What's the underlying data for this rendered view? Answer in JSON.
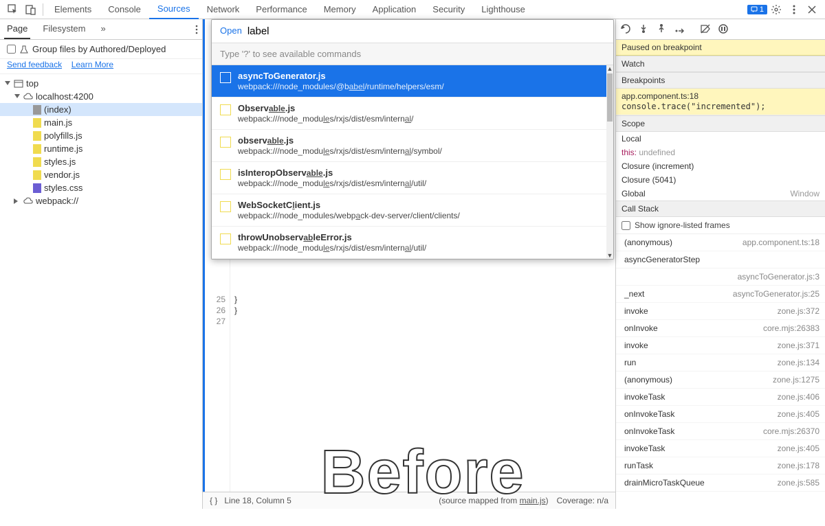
{
  "topTabs": {
    "items": [
      "Elements",
      "Console",
      "Sources",
      "Network",
      "Performance",
      "Memory",
      "Application",
      "Security",
      "Lighthouse"
    ],
    "active": "Sources",
    "badgeCount": "1"
  },
  "leftPanel": {
    "tabs": {
      "page": "Page",
      "filesystem": "Filesystem"
    },
    "grouping": {
      "label": "Group files by Authored/Deployed"
    },
    "links": {
      "feedback": "Send feedback",
      "learn": "Learn More"
    },
    "tree": {
      "top": "top",
      "host": "localhost:4200",
      "files": [
        "(index)",
        "main.js",
        "polyfills.js",
        "runtime.js",
        "styles.js",
        "vendor.js",
        "styles.css"
      ],
      "webpack": "webpack://"
    }
  },
  "palette": {
    "mode": "Open",
    "query": "label",
    "hint": "Type '?' to see available commands",
    "items": [
      {
        "name": "asyncToGenerator.js",
        "path": "webpack:///node_modules/@babel/runtime/helpers/esm/"
      },
      {
        "name": "Observable.js",
        "path": "webpack:///node_modules/rxjs/dist/esm/internal/"
      },
      {
        "name": "observable.js",
        "path": "webpack:///node_modules/rxjs/dist/esm/internal/symbol/"
      },
      {
        "name": "isInteropObservable.js",
        "path": "webpack:///node_modules/rxjs/dist/esm/internal/util/"
      },
      {
        "name": "WebSocketClient.js",
        "path": "webpack:///node_modules/webpack-dev-server/client/clients/"
      },
      {
        "name": "throwUnobservableError.js",
        "path": "webpack:///node_modules/rxjs/dist/esm/internal/util/"
      }
    ]
  },
  "gutter": {
    "l25": "25",
    "l26": "26",
    "l27": "27"
  },
  "code": {
    "l25": "  }",
    "l26": "}"
  },
  "overlayText": "Before",
  "status": {
    "pos": "Line 18, Column 5",
    "mapped": "(source mapped from ",
    "mappedFile": "main.js",
    "mappedEnd": ")",
    "coverage": "Coverage: n/a"
  },
  "debugger": {
    "paused": "Paused on breakpoint",
    "sections": {
      "watch": "Watch",
      "breakpoints": "Breakpoints",
      "scope": "Scope",
      "callstack": "Call Stack"
    },
    "bp": {
      "file": "app.component.ts:18",
      "code": "console.trace(\"incremented\");"
    },
    "scope": {
      "local": "Local",
      "thisLabel": "this:",
      "thisVal": "undefined",
      "c1": "Closure (increment)",
      "c2": "Closure (5041)",
      "global": "Global",
      "globalVal": "Window"
    },
    "ignore": "Show ignore-listed frames",
    "stack": [
      {
        "fn": "(anonymous)",
        "loc": "app.component.ts:18"
      },
      {
        "fn": "asyncGeneratorStep",
        "loc": ""
      },
      {
        "fn": "",
        "loc": "asyncToGenerator.js:3"
      },
      {
        "fn": "_next",
        "loc": "asyncToGenerator.js:25"
      },
      {
        "fn": "invoke",
        "loc": "zone.js:372"
      },
      {
        "fn": "onInvoke",
        "loc": "core.mjs:26383"
      },
      {
        "fn": "invoke",
        "loc": "zone.js:371"
      },
      {
        "fn": "run",
        "loc": "zone.js:134"
      },
      {
        "fn": "(anonymous)",
        "loc": "zone.js:1275"
      },
      {
        "fn": "invokeTask",
        "loc": "zone.js:406"
      },
      {
        "fn": "onInvokeTask",
        "loc": "zone.js:405"
      },
      {
        "fn": "onInvokeTask",
        "loc": "core.mjs:26370"
      },
      {
        "fn": "invokeTask",
        "loc": "zone.js:405"
      },
      {
        "fn": "runTask",
        "loc": "zone.js:178"
      },
      {
        "fn": "drainMicroTaskQueue",
        "loc": "zone.js:585"
      }
    ]
  }
}
